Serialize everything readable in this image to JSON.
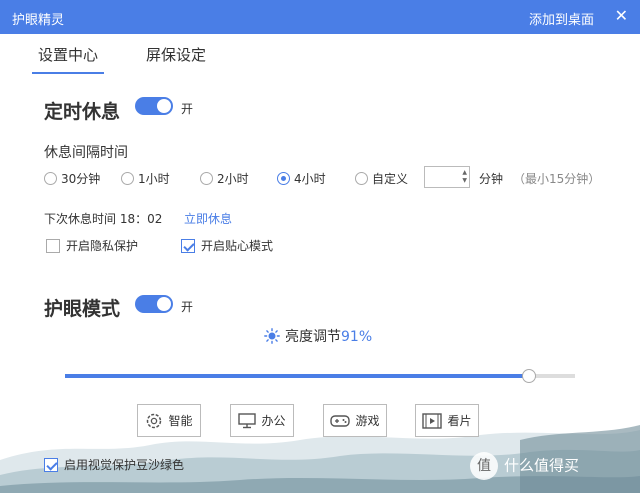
{
  "window": {
    "title": "护眼精灵",
    "add_to_desktop": "添加到桌面"
  },
  "tabs": [
    {
      "label": "设置中心"
    },
    {
      "label": "屏保设定"
    }
  ],
  "timed_rest": {
    "title": "定时休息",
    "toggle_label": "开",
    "interval_label": "休息间隔时间",
    "options": [
      {
        "label": "30分钟"
      },
      {
        "label": "1小时"
      },
      {
        "label": "2小时"
      },
      {
        "label": "4小时"
      },
      {
        "label": "自定义"
      }
    ],
    "selected": "4小时",
    "custom_value": "",
    "unit": "分钟",
    "hint": "（最小15分钟）",
    "next_rest_label": "下次休息时间 18：02",
    "rest_now": "立即休息",
    "privacy_label": "开启隐私保护",
    "privacy_checked": false,
    "caring_label": "开启贴心模式",
    "caring_checked": true
  },
  "eye_mode": {
    "title": "护眼模式",
    "toggle_label": "开",
    "brightness_label": "亮度调节",
    "brightness_value": "91%",
    "brightness_fraction": 0.91,
    "modes": [
      {
        "label": "智能",
        "icon": "gear-icon"
      },
      {
        "label": "办公",
        "icon": "monitor-icon"
      },
      {
        "label": "游戏",
        "icon": "gamepad-icon"
      },
      {
        "label": "看片",
        "icon": "film-icon"
      }
    ]
  },
  "footer": {
    "green_label": "启用视觉保护豆沙绿色",
    "green_checked": true
  },
  "watermark": {
    "badge": "值",
    "text": "什么值得买"
  },
  "colors": {
    "accent": "#4a7ee6"
  }
}
